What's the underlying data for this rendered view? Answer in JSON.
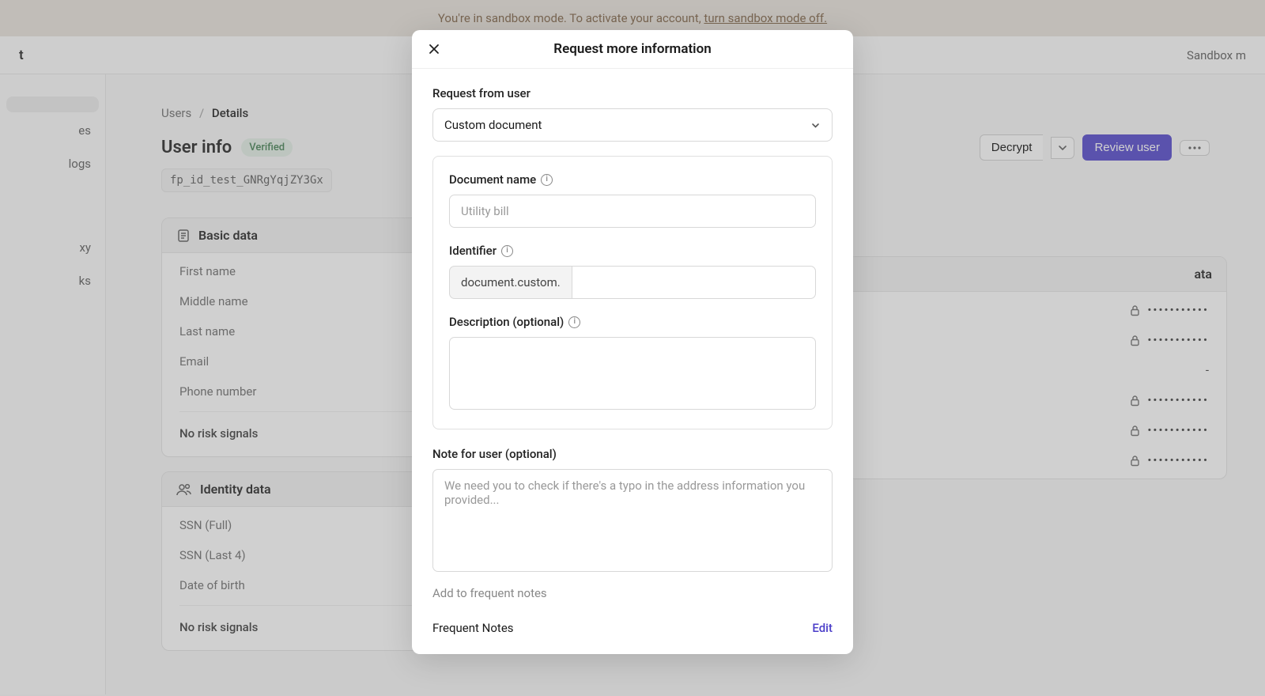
{
  "banner": {
    "text_prefix": "You're in sandbox mode. To activate your account, ",
    "link_text": "turn sandbox mode off."
  },
  "topbar": {
    "left": "t",
    "right": "Sandbox m"
  },
  "sidebar": {
    "items": [
      {
        "label": ""
      },
      {
        "label": "es"
      },
      {
        "label": "logs"
      },
      {
        "label": ""
      },
      {
        "label": "xy"
      },
      {
        "label": "ks"
      }
    ]
  },
  "breadcrumb": {
    "users": "Users",
    "sep": "/",
    "details": "Details"
  },
  "page": {
    "title": "User info",
    "badge": "Verified",
    "id_code": "fp_id_test_GNRgYqjZY3Gx"
  },
  "actions": {
    "decrypt": "Decrypt",
    "review": "Review user"
  },
  "basic_card": {
    "title": "Basic data",
    "rows": [
      "First name",
      "Middle name",
      "Last name",
      "Email",
      "Phone number"
    ],
    "no_risk": "No risk signals"
  },
  "identity_card": {
    "title": "Identity data",
    "rows": [
      "SSN (Full)",
      "SSN (Last 4)",
      "Date of birth"
    ],
    "no_risk": "No risk signals"
  },
  "right_card": {
    "title": "ata",
    "masked": "•••••••••••",
    "dash": "-"
  },
  "modal": {
    "title": "Request more information",
    "request_from_label": "Request from user",
    "select_value": "Custom document",
    "doc_name_label": "Document name",
    "doc_name_placeholder": "Utility bill",
    "identifier_label": "Identifier",
    "identifier_prefix": "document.custom.",
    "description_label": "Description (optional)",
    "note_label": "Note for user (optional)",
    "note_placeholder": "We need you to check if there's a typo in the address information you provided...",
    "add_frequent": "Add to frequent notes",
    "frequent_notes": "Frequent Notes",
    "edit": "Edit"
  }
}
